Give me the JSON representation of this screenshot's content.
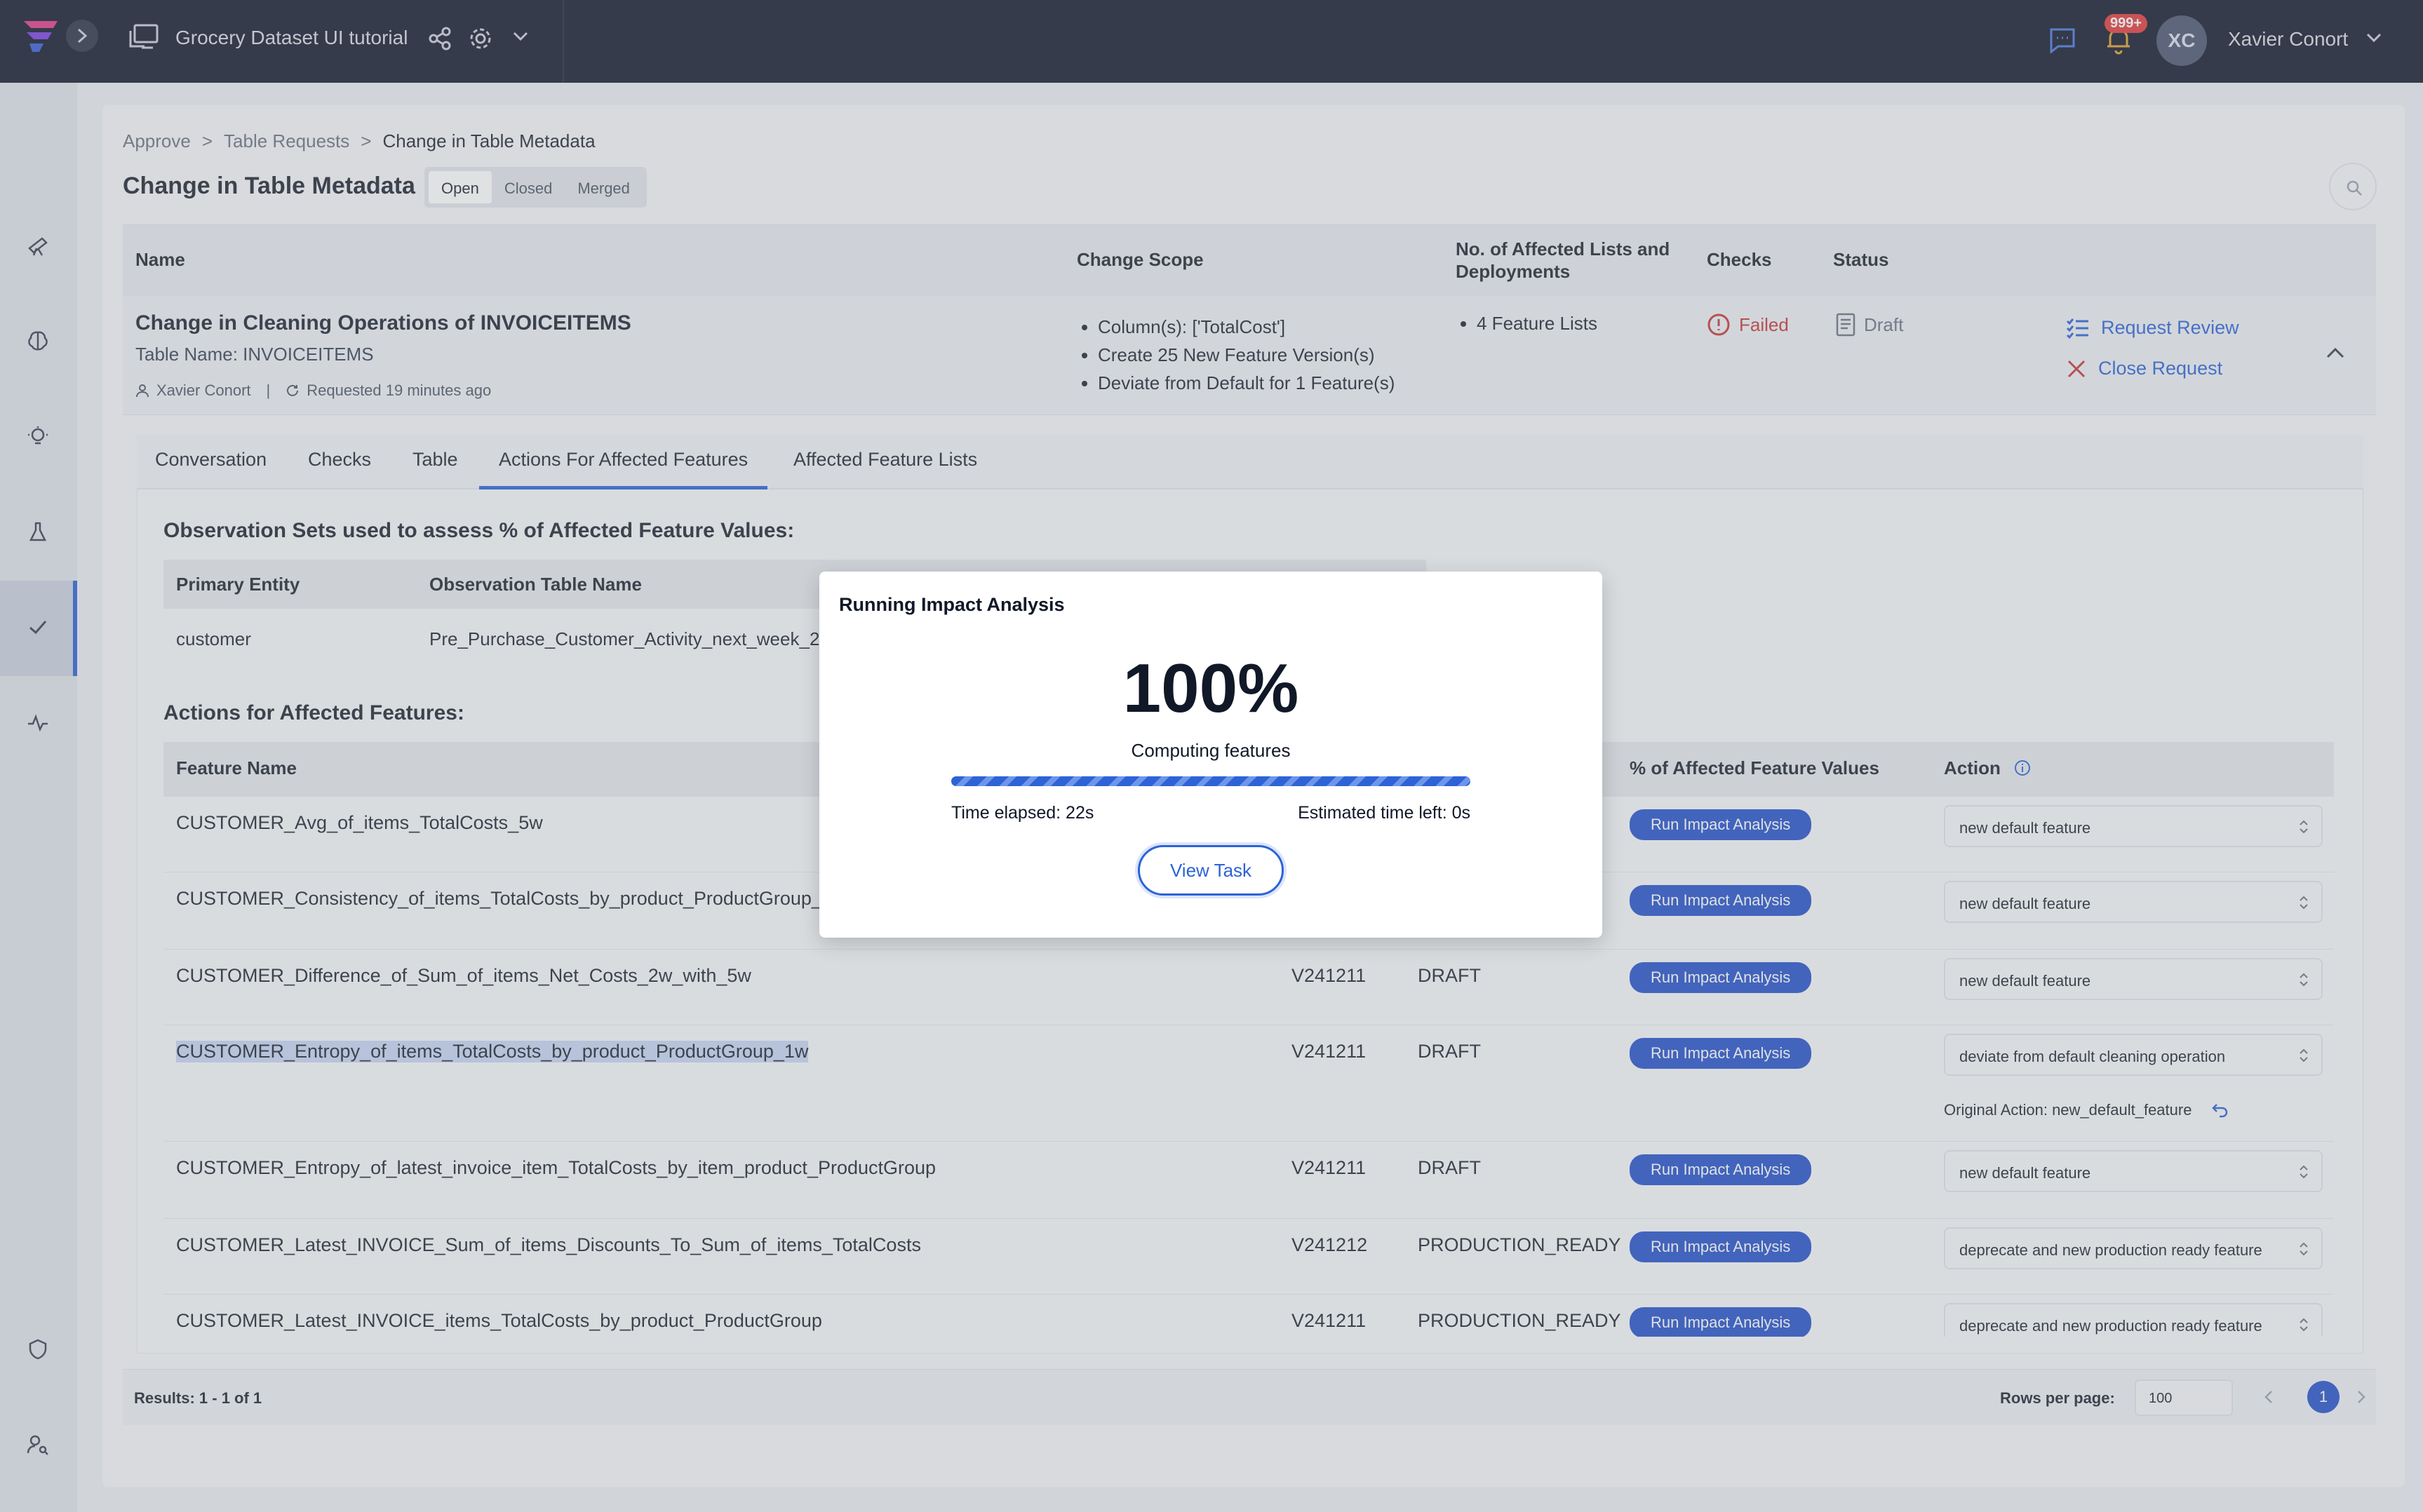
{
  "topbar": {
    "project_title": "Grocery Dataset UI tutorial",
    "notifications_badge": "999+",
    "avatar_initials": "XC",
    "user_name": "Xavier Conort"
  },
  "breadcrumb": {
    "items": [
      "Approve",
      "Table Requests",
      "Change in Table Metadata"
    ],
    "separator": ">"
  },
  "page": {
    "title": "Change in Table Metadata",
    "filters": [
      "Open",
      "Closed",
      "Merged"
    ],
    "active_filter": "Open"
  },
  "request_table": {
    "headers": {
      "name": "Name",
      "scope": "Change Scope",
      "affected": "No. of Affected Lists and Deployments",
      "checks": "Checks",
      "status": "Status"
    },
    "row": {
      "name": "Change in Cleaning Operations of INVOICEITEMS",
      "table_name": "Table Name: INVOICEITEMS",
      "requester": "Xavier Conort",
      "meta_sep": "|",
      "requested": "Requested 19 minutes ago",
      "scope": [
        "Column(s): ['TotalCost']",
        "Create 25 New Feature Version(s)",
        "Deviate from Default for 1 Feature(s)"
      ],
      "affected": [
        "4 Feature Lists"
      ],
      "checks": "Failed",
      "status": "Draft",
      "actions": {
        "review": "Request Review",
        "close": "Close Request"
      }
    }
  },
  "tabs": [
    "Conversation",
    "Checks",
    "Table",
    "Actions For Affected Features",
    "Affected Feature Lists"
  ],
  "active_tab": "Actions For Affected Features",
  "observation": {
    "title": "Observation Sets used to assess % of Affected Feature Values:",
    "headers": [
      "Primary Entity",
      "Observation Table Name"
    ],
    "row": [
      "customer",
      "Pre_Purchase_Customer_Activity_next_week_2"
    ]
  },
  "features": {
    "title": "Actions for Affected Features:",
    "headers": {
      "name": "Feature Name",
      "pct": "% of Affected Feature Values",
      "action": "Action"
    },
    "run_label": "Run Impact Analysis",
    "rows": [
      {
        "name": "CUSTOMER_Avg_of_items_TotalCosts_5w",
        "version": "",
        "status": "",
        "action": "new default feature"
      },
      {
        "name": "CUSTOMER_Consistency_of_items_TotalCosts_by_product_ProductGroup_1w",
        "version": "",
        "status": "",
        "action": "new default feature"
      },
      {
        "name": "CUSTOMER_Difference_of_Sum_of_items_Net_Costs_2w_with_5w",
        "version": "V241211",
        "status": "DRAFT",
        "action": "new default feature"
      },
      {
        "name": "CUSTOMER_Entropy_of_items_TotalCosts_by_product_ProductGroup_1w",
        "version": "V241211",
        "status": "DRAFT",
        "action": "deviate from default cleaning operation",
        "original": "Original Action: new_default_feature"
      },
      {
        "name": "CUSTOMER_Entropy_of_latest_invoice_item_TotalCosts_by_item_product_ProductGroup",
        "version": "V241211",
        "status": "DRAFT",
        "action": "new default feature"
      },
      {
        "name": "CUSTOMER_Latest_INVOICE_Sum_of_items_Discounts_To_Sum_of_items_TotalCosts",
        "version": "V241212",
        "status": "PRODUCTION_READY",
        "action": "deprecate and new production ready feature"
      },
      {
        "name": "CUSTOMER_Latest_INVOICE_items_TotalCosts_by_product_ProductGroup",
        "version": "V241211",
        "status": "PRODUCTION_READY",
        "action": "deprecate and new production ready feature"
      }
    ]
  },
  "footer": {
    "results": "Results: 1 - 1 of 1",
    "rows_per_page_label": "Rows per page:",
    "rows_per_page": "100",
    "page": "1"
  },
  "modal": {
    "title": "Running Impact Analysis",
    "percent": "100%",
    "progress": 1.0,
    "status": "Computing features",
    "elapsed": "Time elapsed: 22s",
    "eta": "Estimated time left: 0s",
    "button": "View Task"
  },
  "colors": {
    "accent": "#2d63d6",
    "topbar": "#141a2c",
    "danger": "#c83737",
    "run_button": "#2652c9"
  }
}
